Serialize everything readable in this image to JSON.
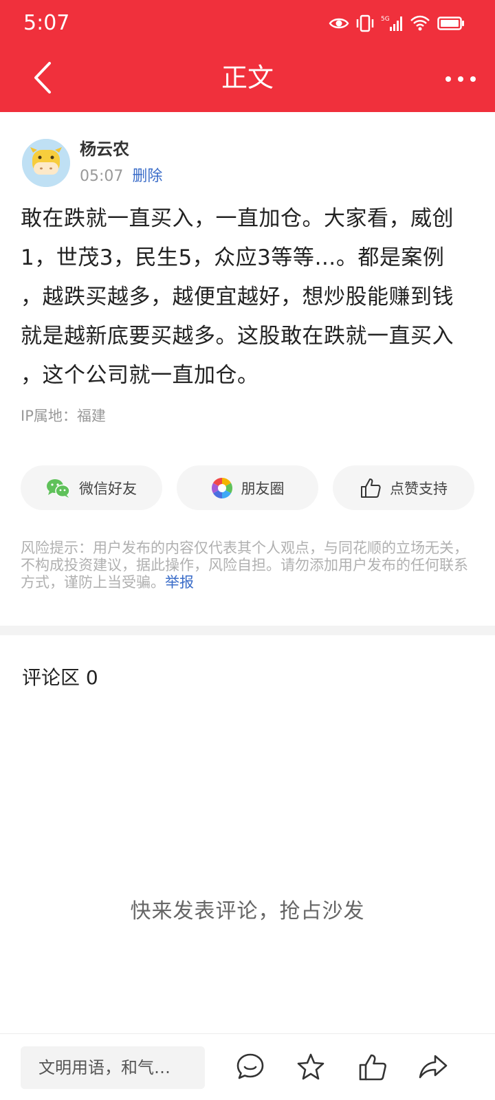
{
  "status_bar": {
    "time": "5:07",
    "network": "5G",
    "icons": [
      "eye-icon",
      "vibrate-icon",
      "signal-icon",
      "wifi-icon",
      "battery-icon"
    ]
  },
  "nav": {
    "title": "正文",
    "back_icon": "chevron-left-icon",
    "more_icon": "more-icon"
  },
  "author": {
    "name": "杨云农",
    "time": "05:07",
    "delete_label": "删除"
  },
  "post": {
    "lines": [
      "敢在跌就一直买入，一直加仓。大家看，威创",
      "1，世茂3，民生5，众应3等等…。都是案例",
      "，越跌买越多，越便宜越好，想炒股能赚到钱",
      "就是越新底要买越多。这股敢在跌就一直买入",
      "，这个公司就一直加仓。"
    ],
    "ip_location": "IP属地：福建"
  },
  "share": {
    "wechat_label": "微信好友",
    "moments_label": "朋友圈",
    "like_label": "点赞支持"
  },
  "risk": {
    "text": "风险提示：用户发布的内容仅代表其个人观点，与同花顺的立场无关，不构成投资建议，据此操作，风险自担。请勿添加用户发布的任何联系方式，谨防上当受骗。",
    "report_label": "举报"
  },
  "comments": {
    "title": "评论区 0",
    "empty_text": "快来发表评论，抢占沙发"
  },
  "bottom_bar": {
    "input_placeholder": "文明用语，和气…",
    "icons": [
      "comment-icon",
      "star-icon",
      "thumbs-up-icon",
      "share-icon"
    ]
  },
  "colors": {
    "brand_red": "#f0303c",
    "link_blue": "#3a6cc8",
    "wechat_green": "#5fc15a"
  }
}
